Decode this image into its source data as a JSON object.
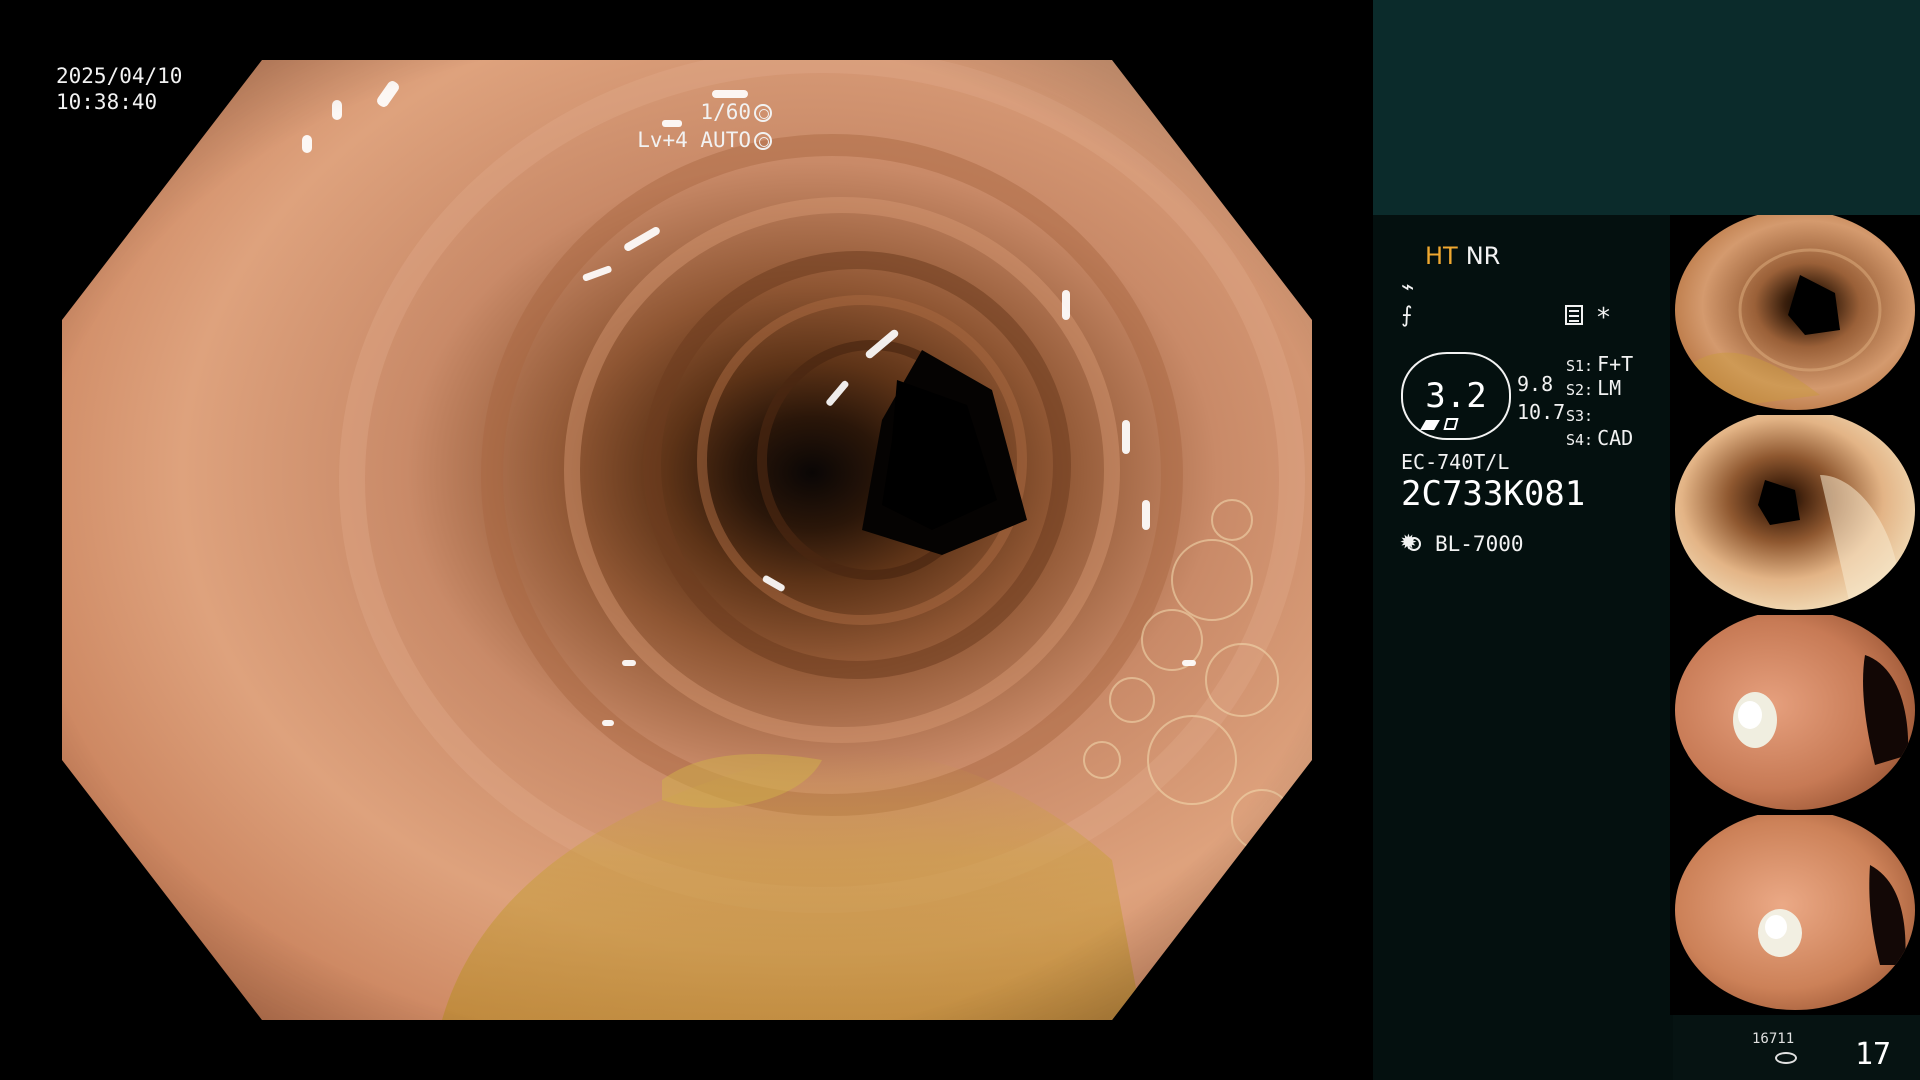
{
  "osd": {
    "date": "2025/04/10",
    "time": "10:38:40",
    "shutter": "1/60",
    "level": "Lv+4 AUTO"
  },
  "panel": {
    "mode_ht": "HT",
    "mode_nr": "NR",
    "zoom_value": "3.2",
    "value_a": "9.8",
    "value_b": "10.7",
    "slots": [
      {
        "key": "S1:",
        "value": "F+T"
      },
      {
        "key": "S2:",
        "value": "LM"
      },
      {
        "key": "S3:",
        "value": ""
      },
      {
        "key": "S4:",
        "value": "CAD"
      }
    ],
    "scope_model": "EC-740T/L",
    "scope_serial": "2C733K081",
    "light_source": "BL-7000",
    "counter_small": "16711",
    "counter_main": "17"
  },
  "icons": {
    "shutter": "aperture-icon",
    "level": "auto-iris-icon",
    "wave1": "enhancement-curve-icon",
    "wave2": "color-tone-icon",
    "setting": "menu-list-icon",
    "asterisk": "asterisk-icon",
    "light": "light-source-icon",
    "storage": "storage-disk-icon"
  },
  "colors": {
    "panel_top": "#0b2b2b",
    "panel_body": "#04100f",
    "accent_ht": "#f0a830"
  }
}
